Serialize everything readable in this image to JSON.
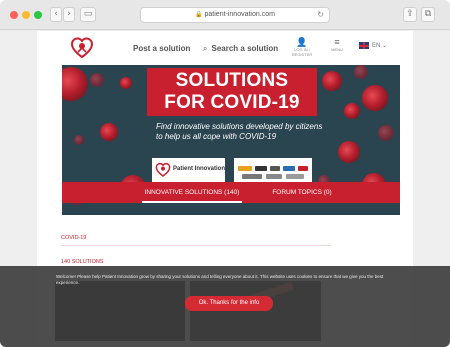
{
  "browser": {
    "back_glyph": "‹",
    "forward_glyph": "›",
    "sidebar_glyph": "▭",
    "url": "patient-innovation.com",
    "lock_glyph": "🔒",
    "reload_glyph": "↻",
    "share_glyph": "⇪",
    "tabs_glyph": "⧉"
  },
  "header": {
    "post_label": "Post a solution",
    "search_label": "Search a solution",
    "search_glyph": "⌕",
    "login_glyph": "👤",
    "login_label": "LOG IN / REGISTER",
    "menu_glyph": "≡",
    "menu_label": "MENU",
    "lang_label": "EN ⌄"
  },
  "hero": {
    "title_line1": "SOLUTIONS",
    "title_line2": "FOR COVID-19",
    "subtitle": "Find innovative solutions developed by citizens to help us all cope with COVID-19",
    "partner_name": "Patient Innovation"
  },
  "tabs": [
    {
      "label": "INNOVATIVE SOLUTIONS (140)"
    },
    {
      "label": "FORUM TOPICS (0)"
    }
  ],
  "content": {
    "breadcrumb": "COVID-19",
    "count": "140 SOLUTIONS"
  },
  "cookie": {
    "message": "Welcome! Please help Patient Innovation grow by sharing your solutions and telling everyone about it. This website uses cookies to ensure that we give you the best experience.",
    "button": "Ok. Thanks for the info"
  },
  "colors": {
    "brand_red": "#c8202e",
    "hero_bg": "#2a4450",
    "cookie_bg": "#3e3e3e"
  }
}
